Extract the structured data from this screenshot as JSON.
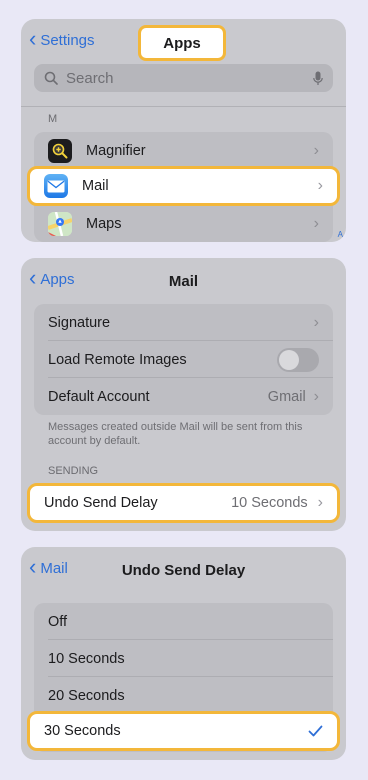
{
  "panel1": {
    "back_label": "Settings",
    "title": "Apps",
    "search_placeholder": "Search",
    "section_letter": "M",
    "items": [
      {
        "label": "Magnifier",
        "icon": "magnifier-app-icon"
      },
      {
        "label": "Mail",
        "icon": "mail-app-icon",
        "highlighted": true
      },
      {
        "label": "Maps",
        "icon": "maps-app-icon"
      }
    ],
    "index_letter": "A"
  },
  "panel2": {
    "back_label": "Apps",
    "title": "Mail",
    "rows": [
      {
        "label": "Signature"
      },
      {
        "label": "Load Remote Images",
        "toggle": false
      },
      {
        "label": "Default Account",
        "value": "Gmail"
      }
    ],
    "footnote": "Messages created outside Mail will be sent from this account by default.",
    "section_header": "SENDING",
    "undo_row": {
      "label": "Undo Send Delay",
      "value": "10 Seconds"
    }
  },
  "panel3": {
    "back_label": "Mail",
    "title": "Undo Send Delay",
    "options": [
      "Off",
      "10 Seconds",
      "20 Seconds",
      "30 Seconds"
    ],
    "selected_index": 3
  },
  "colors": {
    "accent": "#2f6fd6",
    "highlight_border": "#f3b73a"
  }
}
